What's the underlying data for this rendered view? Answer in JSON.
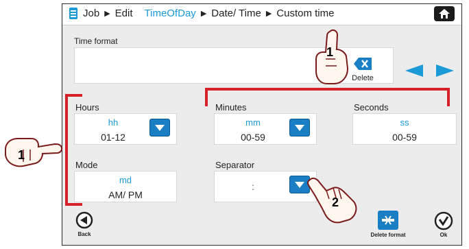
{
  "breadcrumb": {
    "items": [
      {
        "label": "Job",
        "active": false
      },
      {
        "label": "Edit",
        "active": false
      },
      {
        "label": "TimeOfDay",
        "active": true
      },
      {
        "label": "Date/ Time",
        "active": false
      },
      {
        "label": "Custom time",
        "active": false
      }
    ]
  },
  "time_format": {
    "label": "Time format",
    "value": ""
  },
  "delete": {
    "label": "Delete"
  },
  "hours": {
    "label": "Hours",
    "code": "hh",
    "range": "01-12"
  },
  "minutes": {
    "label": "Minutes",
    "code": "mm",
    "range": "00-59"
  },
  "seconds": {
    "label": "Seconds",
    "code": "ss",
    "range": "00-59"
  },
  "mode": {
    "label": "Mode",
    "code": "md",
    "range": "AM/ PM"
  },
  "separator": {
    "label": "Separator",
    "value": ":"
  },
  "footer": {
    "back_label": "Back",
    "delete_format_label": "Delete format",
    "ok_label": "Ok"
  },
  "callouts": {
    "one": "1",
    "two": "2",
    "three": "1"
  },
  "colors": {
    "accent": "#1a9ad6",
    "highlight": "#d62027",
    "button": "#1a7ec4"
  }
}
